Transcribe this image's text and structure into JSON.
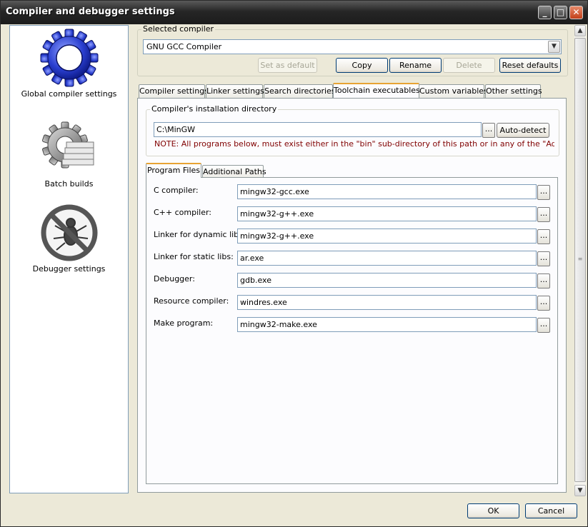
{
  "window": {
    "title": "Compiler and debugger settings",
    "min_label": "_",
    "max_label": "□",
    "close_label": "✕"
  },
  "sidebar": {
    "items": [
      {
        "label": "Global compiler settings",
        "icon": "gear-icon"
      },
      {
        "label": "Batch builds",
        "icon": "batch-gear-icon"
      },
      {
        "label": "Debugger settings",
        "icon": "no-bug-icon"
      }
    ]
  },
  "compiler": {
    "group_label": "Selected compiler",
    "selected": "GNU GCC Compiler",
    "dropdown_arrow": "▼",
    "buttons": {
      "set_default": "Set as default",
      "copy": "Copy",
      "rename": "Rename",
      "delete": "Delete",
      "reset": "Reset defaults"
    }
  },
  "tabs": [
    {
      "label": "Compiler settings"
    },
    {
      "label": "Linker settings"
    },
    {
      "label": "Search directories"
    },
    {
      "label": "Toolchain executables"
    },
    {
      "label": "Custom variables"
    },
    {
      "label": "Other settings"
    }
  ],
  "install": {
    "group_label": "Compiler's installation directory",
    "path": "C:\\MinGW",
    "browse": "...",
    "autodetect": "Auto-detect",
    "note": "NOTE: All programs below, must exist either in the \"bin\" sub-directory of this path or in any of the \"Additional"
  },
  "subtabs": [
    {
      "label": "Program Files"
    },
    {
      "label": "Additional Paths"
    }
  ],
  "programs": [
    {
      "label": "C compiler:",
      "value": "mingw32-gcc.exe"
    },
    {
      "label": "C++ compiler:",
      "value": "mingw32-g++.exe"
    },
    {
      "label": "Linker for dynamic libs:",
      "value": "mingw32-g++.exe"
    },
    {
      "label": "Linker for static libs:",
      "value": "ar.exe"
    },
    {
      "label": "Debugger:",
      "value": "gdb.exe"
    },
    {
      "label": "Resource compiler:",
      "value": "windres.exe"
    },
    {
      "label": "Make program:",
      "value": "mingw32-make.exe"
    }
  ],
  "browse_label": "...",
  "footer": {
    "ok": "OK",
    "cancel": "Cancel"
  },
  "scrollbar": {
    "up": "▲",
    "down": "▼",
    "grip": "≡"
  }
}
